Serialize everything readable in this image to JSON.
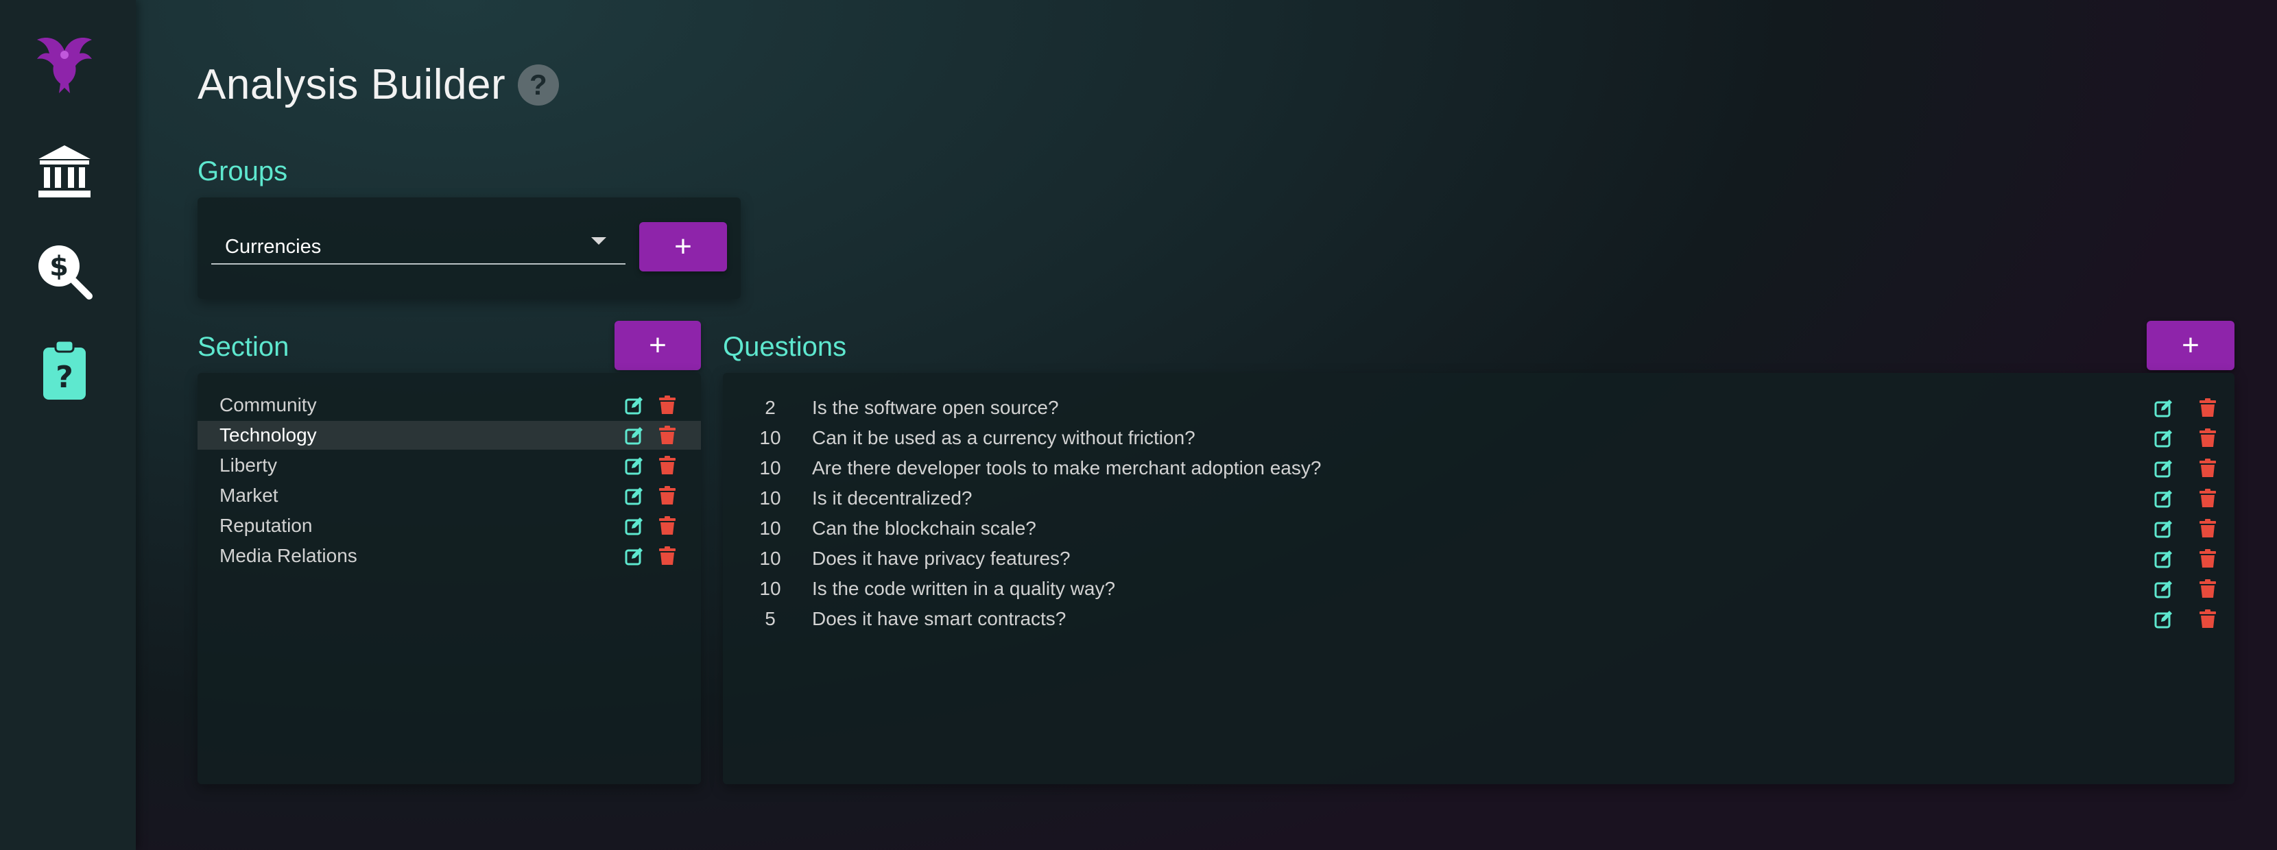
{
  "sidebar": {
    "items": [
      {
        "icon": "phoenix-logo-icon"
      },
      {
        "icon": "bank-icon"
      },
      {
        "icon": "money-search-icon"
      },
      {
        "icon": "clipboard-question-icon"
      }
    ]
  },
  "page": {
    "title": "Analysis Builder",
    "help_icon": "?"
  },
  "groups": {
    "heading": "Groups",
    "selected": "Currencies",
    "add_label": "+"
  },
  "sections": {
    "heading": "Section",
    "add_label": "+",
    "active_index": 1,
    "items": [
      {
        "label": "Community"
      },
      {
        "label": "Technology"
      },
      {
        "label": "Liberty"
      },
      {
        "label": "Market"
      },
      {
        "label": "Reputation"
      },
      {
        "label": "Media Relations"
      }
    ]
  },
  "questions": {
    "heading": "Questions",
    "add_label": "+",
    "items": [
      {
        "weight": "2",
        "text": "Is the software open source?"
      },
      {
        "weight": "10",
        "text": "Can it be used as a currency without friction?"
      },
      {
        "weight": "10",
        "text": "Are there developer tools to make merchant adoption easy?"
      },
      {
        "weight": "10",
        "text": "Is it decentralized?"
      },
      {
        "weight": "10",
        "text": "Can the blockchain scale?"
      },
      {
        "weight": "10",
        "text": "Does it have privacy features?"
      },
      {
        "weight": "10",
        "text": "Is the code written in a quality way?"
      },
      {
        "weight": "5",
        "text": "Does it have smart contracts?"
      }
    ]
  },
  "colors": {
    "accent": "#5ee8cf",
    "button": "#8e24aa",
    "delete": "#e84b3c",
    "edit": "#5ee8cf",
    "logo": "#8e24aa"
  }
}
